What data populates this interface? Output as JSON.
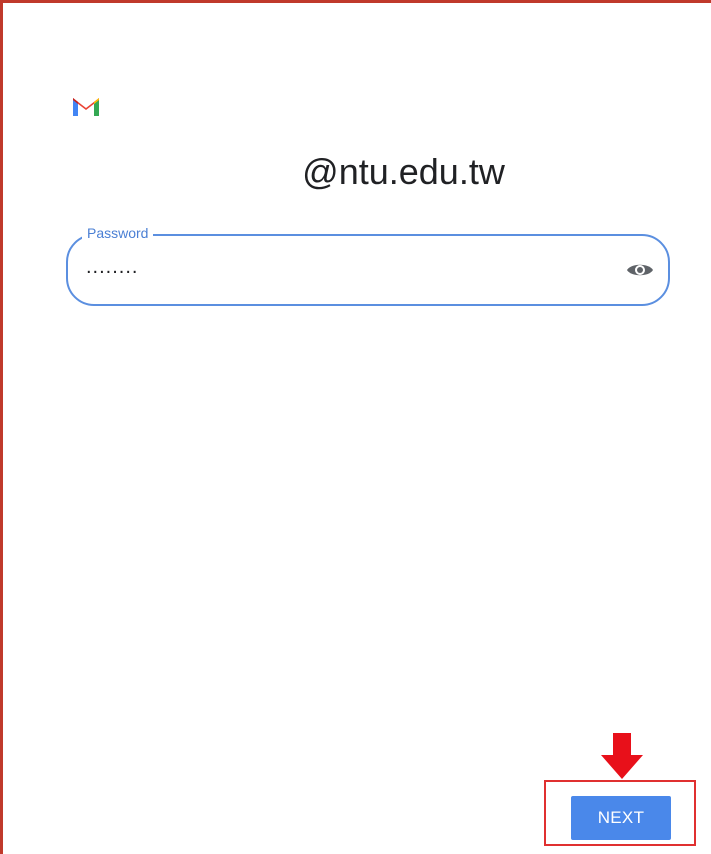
{
  "account": {
    "email_domain": "@ntu.edu.tw"
  },
  "password_field": {
    "label": "Password",
    "masked_value": "........"
  },
  "actions": {
    "next_label": "NEXT"
  },
  "icons": {
    "logo": "gmail-logo-icon",
    "visibility": "eye-icon",
    "annotation": "arrow-down-icon"
  },
  "colors": {
    "accent_blue": "#4a88ea",
    "field_border": "#5b8fe0",
    "annotation_red": "#e03030"
  }
}
